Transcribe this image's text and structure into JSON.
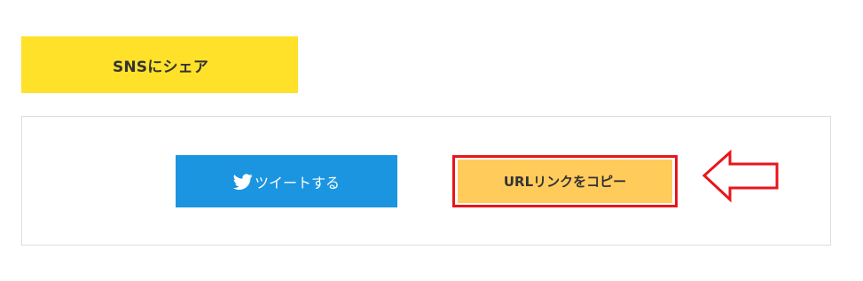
{
  "share_heading": {
    "label": "SNSにシェア",
    "background": "#FFE12A"
  },
  "tweet_button": {
    "label": "ツイートする",
    "icon": "twitter-bird-icon",
    "background": "#1B95E0"
  },
  "copy_button": {
    "label": "URLリンクをコピー",
    "background": "#FFCC5C",
    "highlight_color": "#E8151D"
  },
  "annotation": {
    "icon": "left-arrow-outline-icon",
    "color": "#E8151D"
  }
}
